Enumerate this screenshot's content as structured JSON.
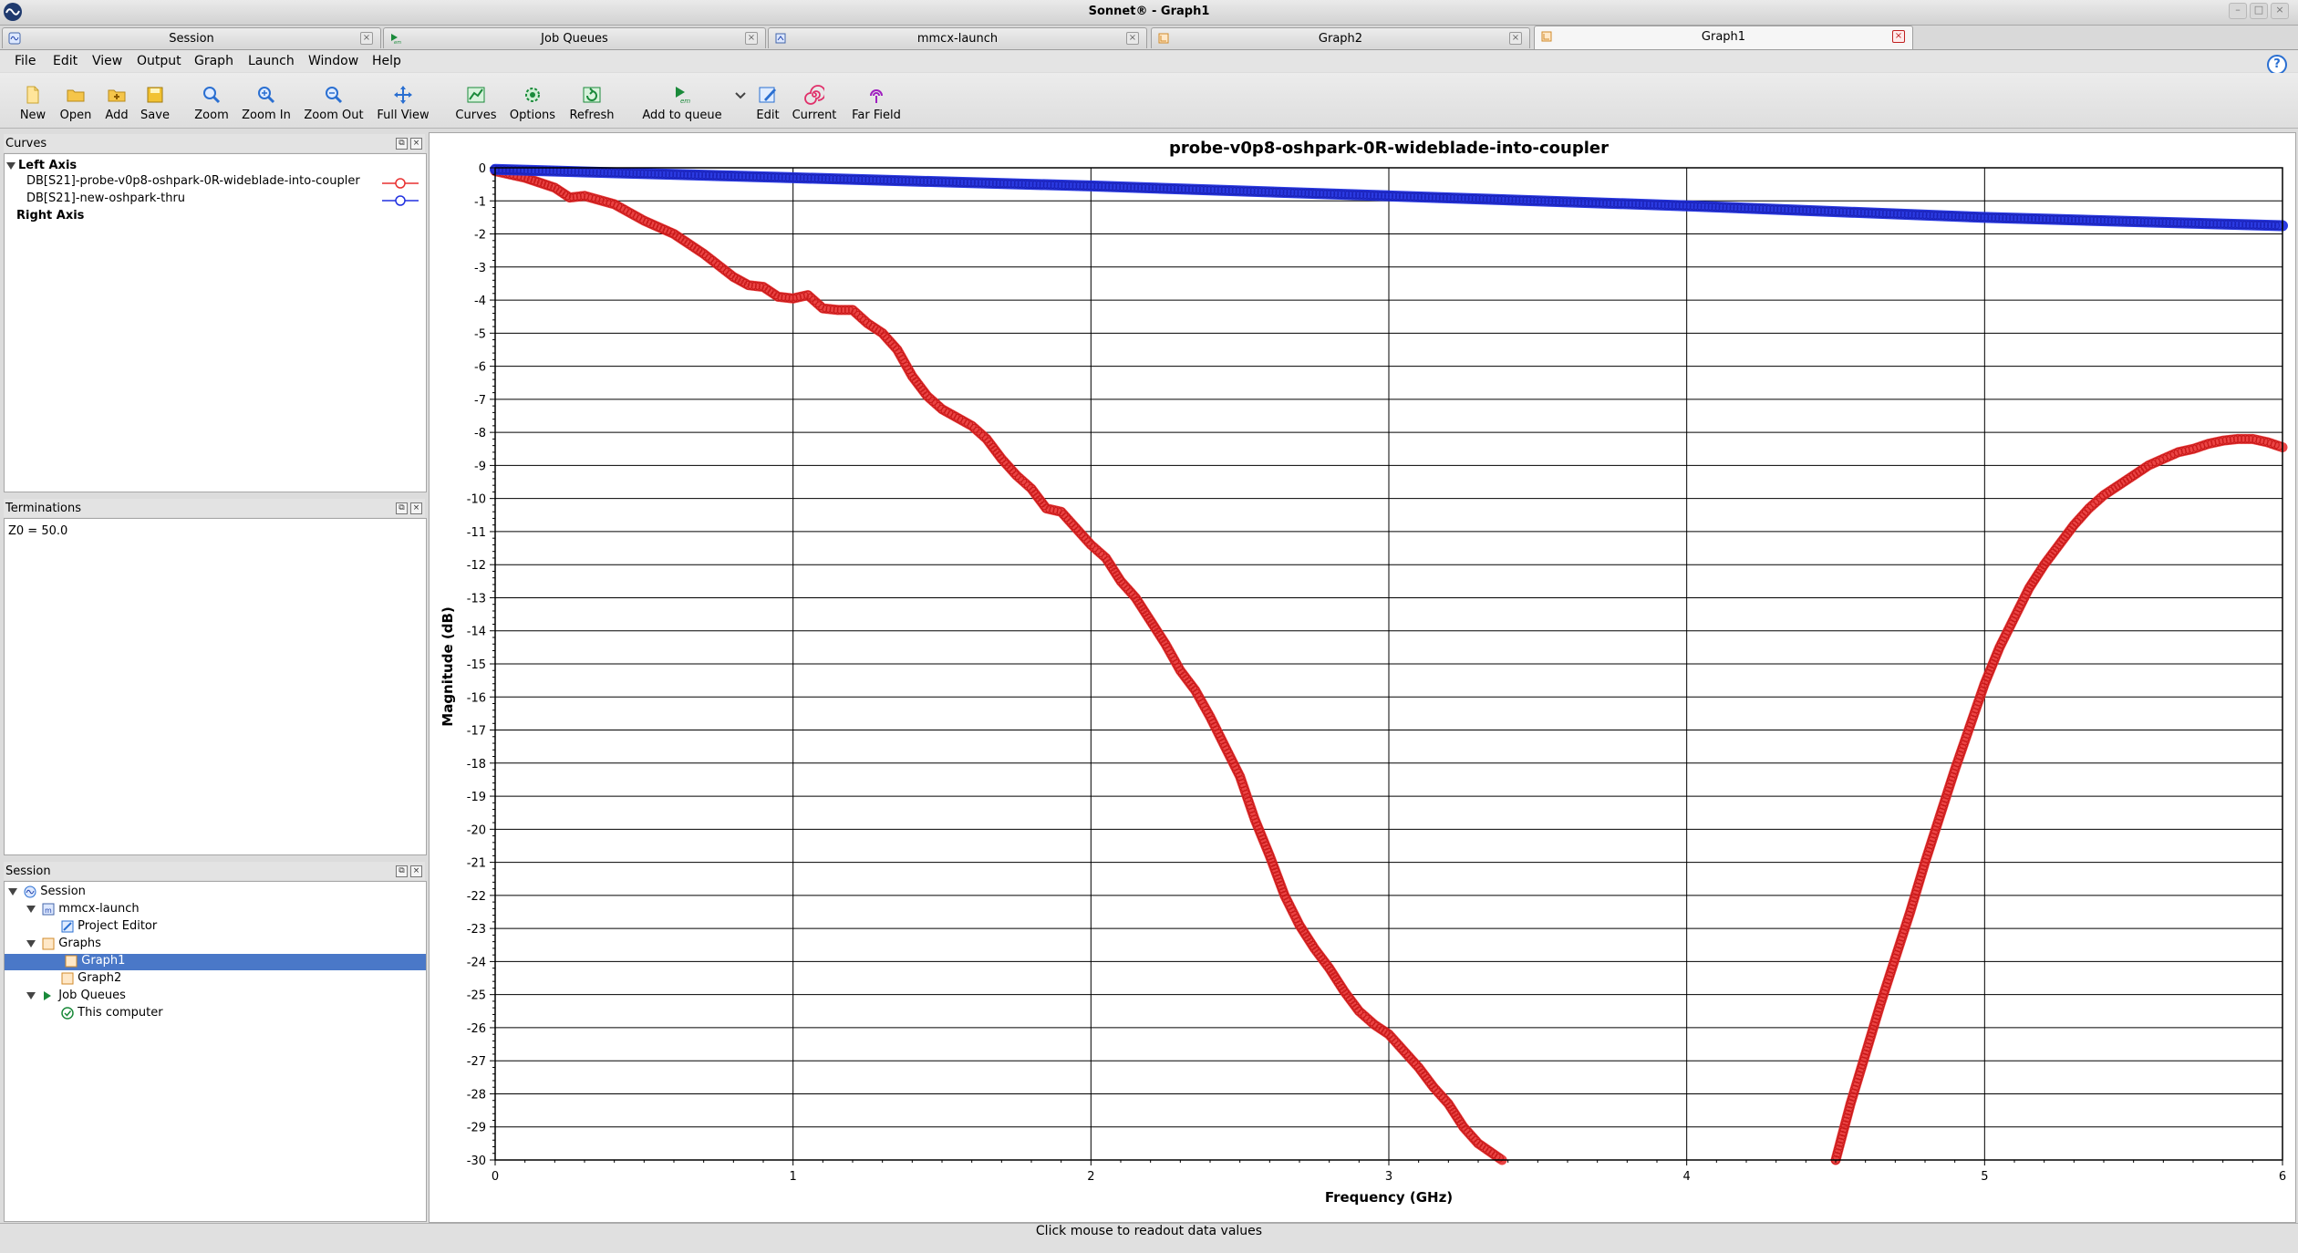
{
  "window": {
    "title": "Sonnet® - Graph1"
  },
  "tabs": [
    {
      "label": "Session",
      "icon": "sonnet-session-icon"
    },
    {
      "label": "Job Queues",
      "icon": "job-queue-icon"
    },
    {
      "label": "mmcx-launch",
      "icon": "project-icon"
    },
    {
      "label": "Graph2",
      "icon": "graph-icon"
    },
    {
      "label": "Graph1",
      "icon": "graph-icon",
      "active": true
    }
  ],
  "menu": [
    "File",
    "Edit",
    "View",
    "Output",
    "Graph",
    "Launch",
    "Window",
    "Help"
  ],
  "toolbar": {
    "new": "New",
    "open": "Open",
    "add": "Add",
    "save": "Save",
    "zoom": "Zoom",
    "zoom_in": "Zoom In",
    "zoom_out": "Zoom Out",
    "full_view": "Full View",
    "curves": "Curves",
    "options": "Options",
    "refresh": "Refresh",
    "add_to_queue": "Add to queue",
    "edit": "Edit",
    "current": "Current",
    "far_field": "Far Field",
    "em_badge": "em"
  },
  "curves_panel": {
    "title": "Curves",
    "left_axis": "Left Axis",
    "right_axis": "Right Axis",
    "items": [
      {
        "label": "DB[S21]-probe-v0p8-oshpark-0R-wideblade-into-coupler",
        "color": "#e83030"
      },
      {
        "label": "DB[S21]-new-oshpark-thru",
        "color": "#2030e0"
      }
    ]
  },
  "terminations_panel": {
    "title": "Terminations",
    "z0": "Z0 = 50.0"
  },
  "session_panel": {
    "title": "Session",
    "items": [
      {
        "label": "Session"
      },
      {
        "label": "mmcx-launch"
      },
      {
        "label": "Project Editor"
      },
      {
        "label": "Graphs"
      },
      {
        "label": "Graph1",
        "selected": true
      },
      {
        "label": "Graph2"
      },
      {
        "label": "Job Queues"
      },
      {
        "label": "This computer"
      }
    ]
  },
  "status": {
    "text": "Click mouse to readout data values"
  },
  "chart_data": {
    "type": "line",
    "title": "probe-v0p8-oshpark-0R-wideblade-into-coupler",
    "xlabel": "Frequency (GHz)",
    "ylabel": "Magnitude (dB)",
    "xlim": [
      0,
      6
    ],
    "ylim": [
      -30,
      0
    ],
    "xticks": [
      "0",
      "1",
      "2",
      "3",
      "4",
      "5",
      "6"
    ],
    "yticks": [
      "0",
      "-1",
      "-2",
      "-3",
      "-4",
      "-5",
      "-6",
      "-7",
      "-8",
      "-9",
      "-10",
      "-11",
      "-12",
      "-13",
      "-14",
      "-15",
      "-16",
      "-17",
      "-18",
      "-19",
      "-20",
      "-21",
      "-22",
      "-23",
      "-24",
      "-25",
      "-26",
      "-27",
      "-28",
      "-29",
      "-30"
    ],
    "grid": true,
    "series": [
      {
        "name": "DB[S21]-probe-v0p8-oshpark-0R-wideblade-into-coupler",
        "color": "#e83030",
        "x": [
          0,
          0.1,
          0.2,
          0.25,
          0.3,
          0.4,
          0.5,
          0.6,
          0.7,
          0.8,
          0.85,
          0.9,
          0.95,
          1.0,
          1.05,
          1.1,
          1.15,
          1.2,
          1.25,
          1.3,
          1.35,
          1.4,
          1.45,
          1.5,
          1.6,
          1.65,
          1.7,
          1.75,
          1.8,
          1.85,
          1.9,
          1.95,
          2.0,
          2.05,
          2.1,
          2.15,
          2.2,
          2.25,
          2.3,
          2.35,
          2.4,
          2.45,
          2.5,
          2.55,
          2.6,
          2.65,
          2.7,
          2.75,
          2.8,
          2.85,
          2.9,
          2.95,
          3.0,
          3.05,
          3.1,
          3.15,
          3.2,
          3.25,
          3.3,
          3.38
        ],
        "y": [
          -0.1,
          -0.3,
          -0.6,
          -0.9,
          -0.85,
          -1.1,
          -1.6,
          -2.0,
          -2.6,
          -3.3,
          -3.55,
          -3.6,
          -3.9,
          -3.95,
          -3.85,
          -4.25,
          -4.3,
          -4.3,
          -4.7,
          -5.0,
          -5.5,
          -6.3,
          -6.9,
          -7.3,
          -7.8,
          -8.2,
          -8.8,
          -9.3,
          -9.7,
          -10.3,
          -10.4,
          -10.9,
          -11.4,
          -11.8,
          -12.5,
          -13.0,
          -13.7,
          -14.4,
          -15.2,
          -15.8,
          -16.6,
          -17.5,
          -18.4,
          -19.7,
          -20.8,
          -22.0,
          -22.9,
          -23.6,
          -24.2,
          -24.9,
          -25.5,
          -25.9,
          -26.2,
          -26.7,
          -27.2,
          -27.8,
          -28.3,
          -29.0,
          -29.5,
          -30.0
        ]
      },
      {
        "name": "DB[S21]-new-oshpark-thru",
        "color": "#2030e0",
        "x": [
          0,
          1,
          2,
          3,
          4,
          5,
          6
        ],
        "y": [
          -0.05,
          -0.3,
          -0.55,
          -0.85,
          -1.15,
          -1.5,
          -1.75
        ]
      },
      {
        "name": "DB[S21]-probe-v0p8-oshpark-0R-wideblade-into-coupler",
        "color": "#e83030",
        "x": [
          4.5,
          4.55,
          4.6,
          4.65,
          4.7,
          4.75,
          4.8,
          4.85,
          4.9,
          4.95,
          5.0,
          5.05,
          5.1,
          5.15,
          5.2,
          5.25,
          5.3,
          5.35,
          5.4,
          5.45,
          5.5,
          5.55,
          5.6,
          5.65,
          5.7,
          5.75,
          5.8,
          5.85,
          5.9,
          5.95,
          6.0
        ],
        "y": [
          -30.0,
          -28.3,
          -26.8,
          -25.3,
          -23.9,
          -22.5,
          -21.0,
          -19.6,
          -18.2,
          -16.9,
          -15.6,
          -14.5,
          -13.6,
          -12.7,
          -12.0,
          -11.4,
          -10.8,
          -10.3,
          -9.9,
          -9.6,
          -9.3,
          -9.0,
          -8.8,
          -8.6,
          -8.5,
          -8.35,
          -8.25,
          -8.2,
          -8.2,
          -8.3,
          -8.45
        ]
      }
    ]
  }
}
